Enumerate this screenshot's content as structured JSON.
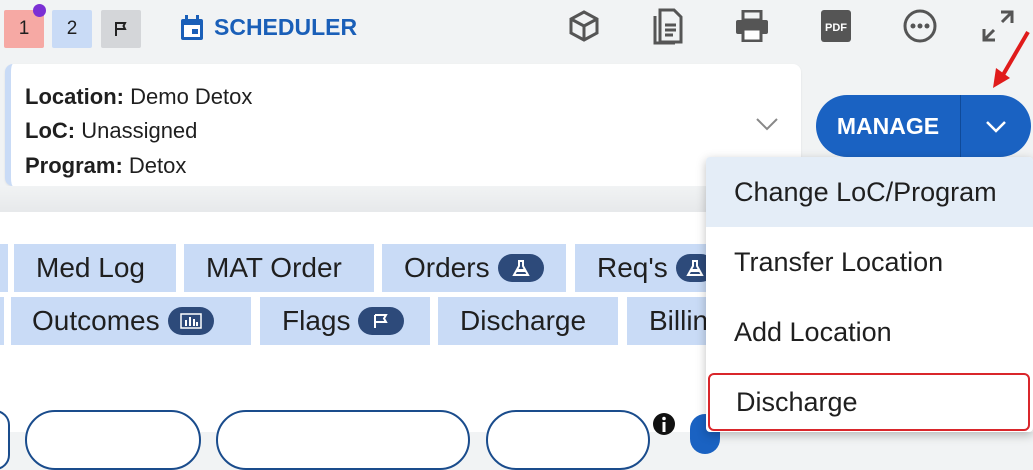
{
  "topbar": {
    "count_1": "1",
    "count_2": "2",
    "scheduler_label": "SCHEDULER",
    "icons": [
      "flag-icon",
      "calendar-icon",
      "package-icon",
      "document-icon",
      "print-icon",
      "pdf-icon",
      "more-icon",
      "expand-icon"
    ],
    "pdf_text": "PDF"
  },
  "patient": {
    "location_label": "Location:",
    "location_value": "Demo Detox",
    "loc_label": "LoC:",
    "loc_value": "Unassigned",
    "program_label": "Program:",
    "program_value": "Detox"
  },
  "manage": {
    "label": "MANAGE"
  },
  "tabs": {
    "row1": [
      "Med Log",
      "MAT Order",
      "Orders",
      "Req's"
    ],
    "row2": [
      "Outcomes",
      "Flags",
      "Discharge",
      "Billing"
    ]
  },
  "menu": {
    "items": [
      "Change LoC/Program",
      "Transfer Location",
      "Add Location",
      "Discharge"
    ]
  },
  "colors": {
    "accent": "#1a62c2",
    "tab_bg": "#c9dbf6",
    "highlight": "#d9262b"
  }
}
